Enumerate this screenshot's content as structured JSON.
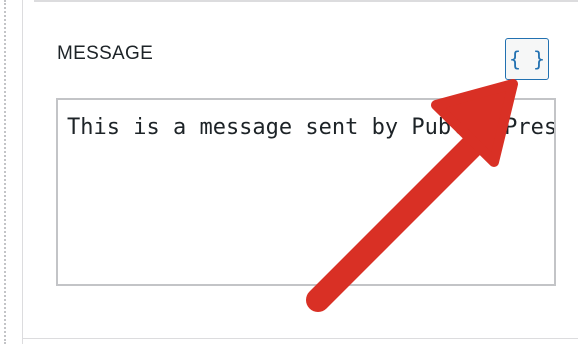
{
  "field": {
    "label": "MESSAGE",
    "token_button_label": "{ }",
    "message_value": "This is a message sent by PublishPress"
  },
  "annotation": {
    "arrow_color": "#d93025",
    "arrow_icon": "annotation-arrow-icon"
  },
  "colors": {
    "accent": "#2271b1",
    "border": "#c3c4c7",
    "text": "#1d2327"
  }
}
